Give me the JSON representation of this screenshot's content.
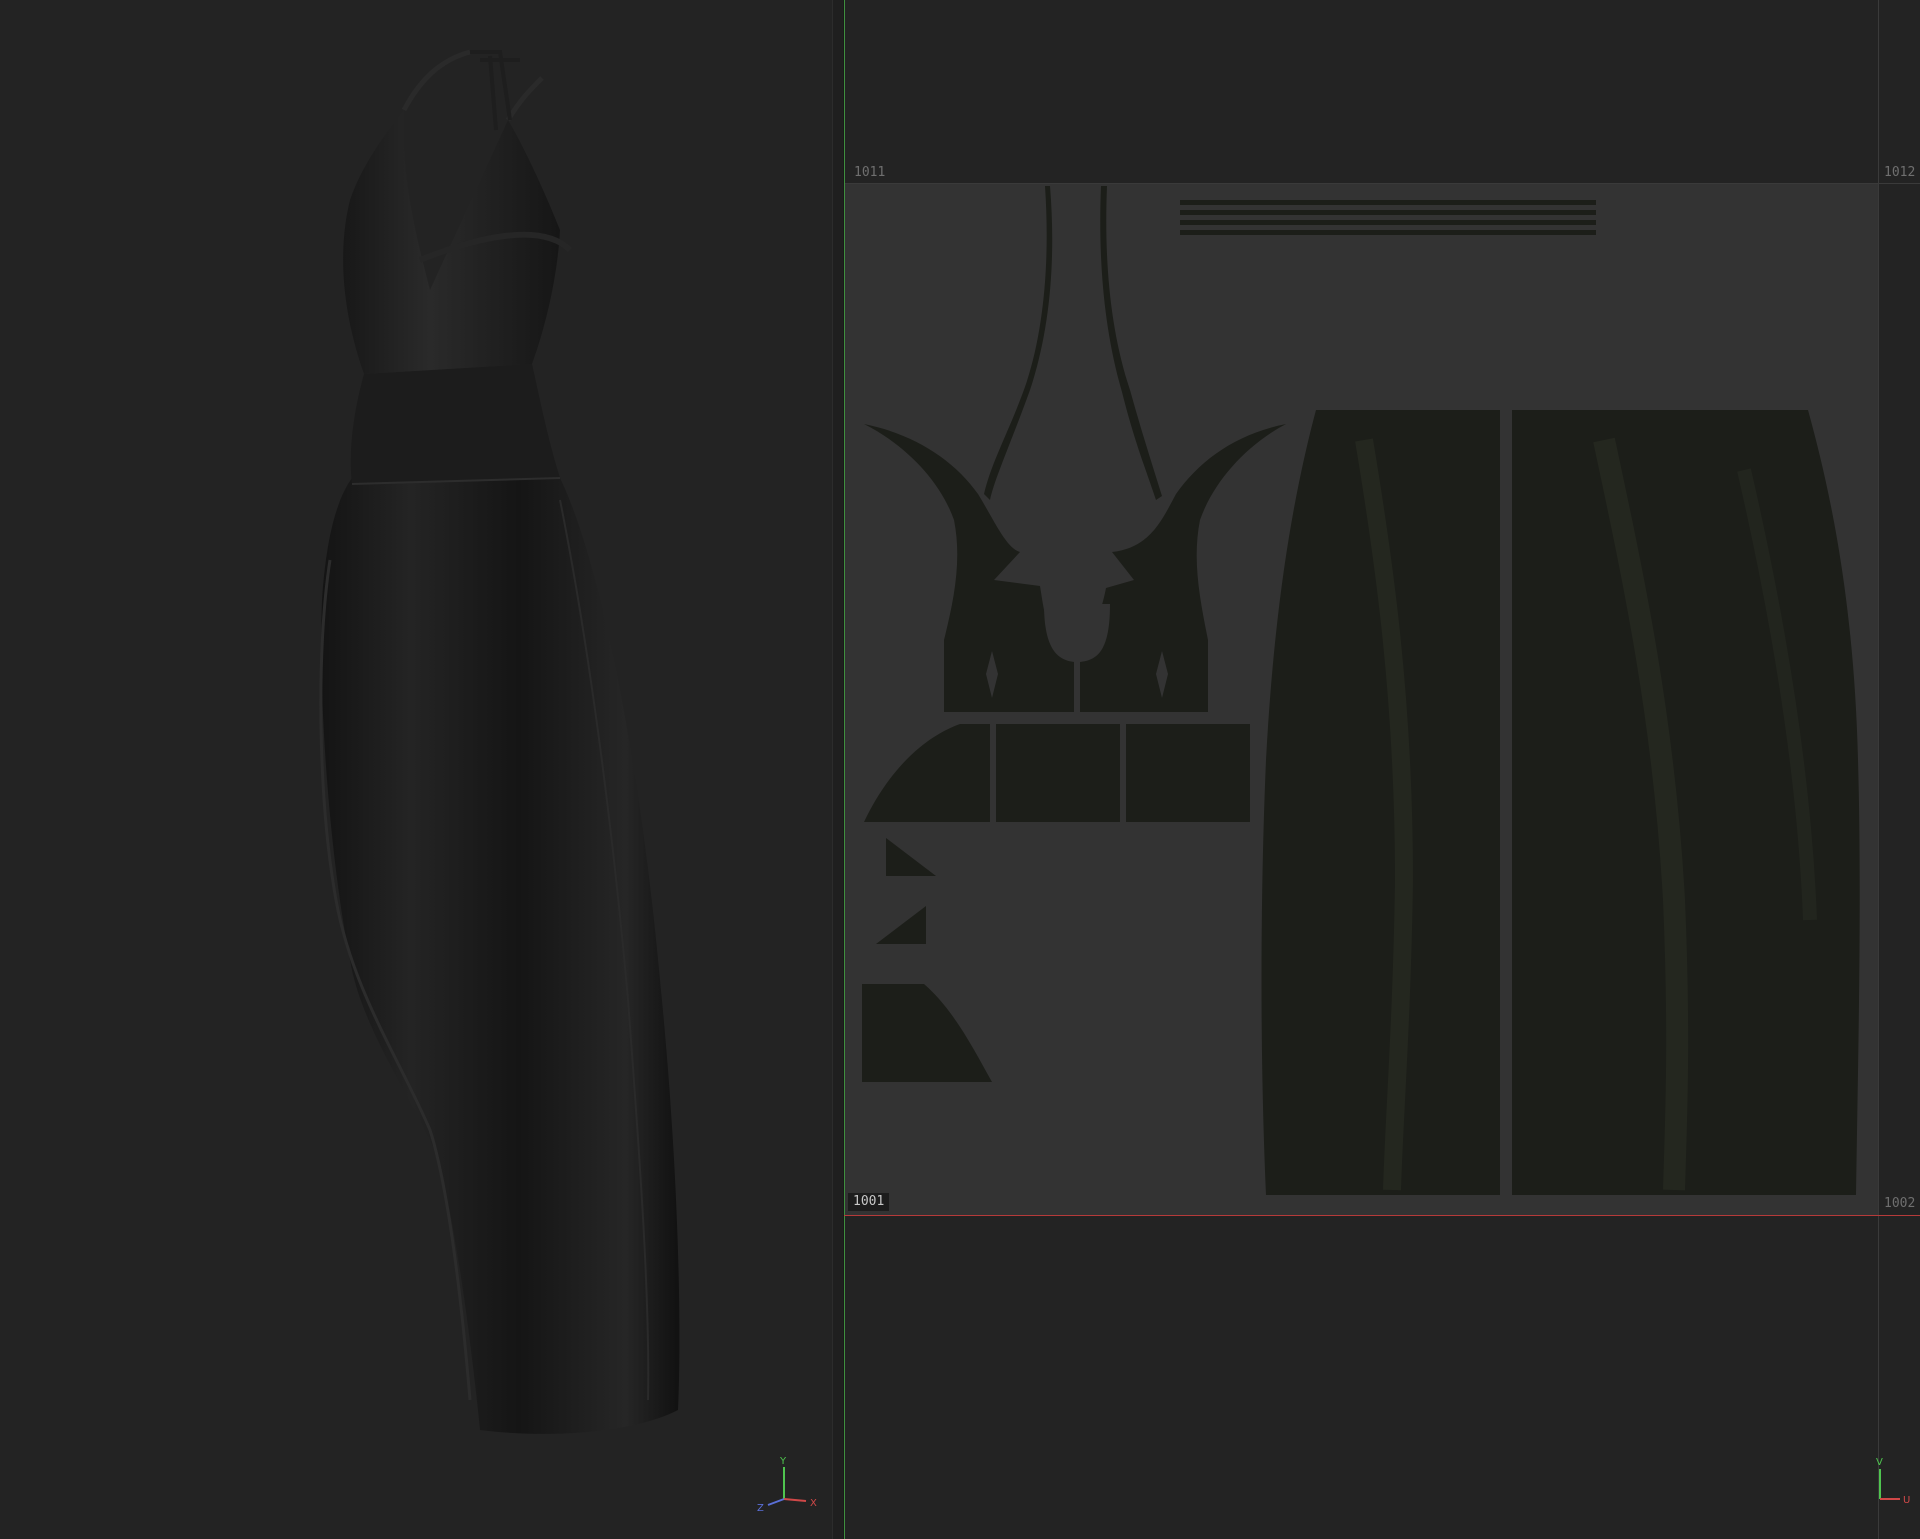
{
  "viewport3d": {
    "axis_gizmo": {
      "x_label": "X",
      "y_label": "Y",
      "z_label": "Z"
    },
    "colors": {
      "x_axis": "#d04848",
      "y_axis": "#4fc44f",
      "z_axis": "#5a6fd8"
    }
  },
  "uv_editor": {
    "tiles": {
      "top_left": "1011",
      "top_right": "1012",
      "bottom_left_current": "1001",
      "bottom_right": "1002"
    },
    "axis_gizmo": {
      "u_label": "U",
      "v_label": "V"
    },
    "colors": {
      "u_axis": "#d04848",
      "v_axis": "#4fc44f",
      "tile_fill": "#333333",
      "uv_shell": "#1c1e19"
    }
  }
}
